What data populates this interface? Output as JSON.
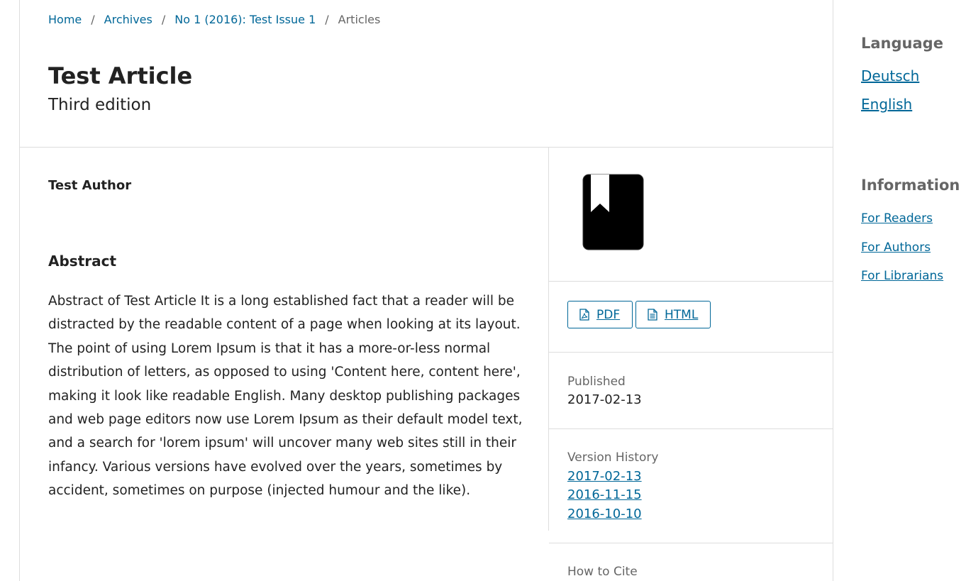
{
  "breadcrumb": {
    "items": [
      "Home",
      "Archives",
      "No 1 (2016): Test Issue 1"
    ],
    "current": "Articles",
    "separator": "/"
  },
  "article": {
    "title": "Test Article",
    "subtitle": "Third edition",
    "author": "Test Author",
    "abstract_heading": "Abstract",
    "abstract_text": "Abstract of Test Article It is a long established fact that a reader will be distracted by the readable content of a page when looking at its layout. The point of using Lorem Ipsum is that it has a more-or-less normal distribution of letters, as opposed to using 'Content here, content here', making it look like readable English. Many desktop publishing packages and web page editors now use Lorem Ipsum as their default model text, and a search for 'lorem ipsum' will uncover many web sites still in their infancy. Various versions have evolved over the years, sometimes by accident, sometimes on purpose (injected humour and the like)."
  },
  "details": {
    "cover_icon": "book-bookmark-icon",
    "galleys": [
      {
        "label": "PDF",
        "icon": "file-pdf-icon"
      },
      {
        "label": "HTML",
        "icon": "file-text-icon"
      }
    ],
    "published_label": "Published",
    "published_date": "2017-02-13",
    "version_history_label": "Version History",
    "versions": [
      "2017-02-13",
      "2016-11-15",
      "2016-10-10"
    ],
    "how_to_cite_label": "How to Cite"
  },
  "sidebar": {
    "language_heading": "Language",
    "languages": [
      "Deutsch",
      "English"
    ],
    "information_heading": "Information",
    "information_links": [
      "For Readers",
      "For Authors",
      "For Librarians"
    ]
  },
  "colors": {
    "link": "#006798",
    "muted": "#666666",
    "text": "#222222",
    "border": "#dddddd"
  }
}
